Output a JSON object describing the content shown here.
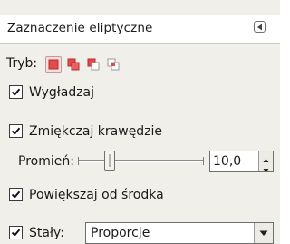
{
  "panel": {
    "title": "Zaznaczenie eliptyczne",
    "mode_label": "Tryb:",
    "modes": [
      "replace",
      "add",
      "subtract",
      "intersect"
    ],
    "active_mode": "replace",
    "antialias": {
      "label": "Wygładzaj",
      "checked": true
    },
    "feather": {
      "label": "Zmiękczaj krawędzie",
      "checked": true
    },
    "radius": {
      "label": "Promień:",
      "value": "10,0"
    },
    "expand_from_center": {
      "label": "Powiększaj od środka",
      "checked": true
    },
    "fixed": {
      "label": "Stały:",
      "checked": true,
      "selected": "Proporcje"
    }
  },
  "colors": {
    "accent": "#e34a4a",
    "panel_bg": "#f0efe9"
  },
  "icons": [
    "panel-menu-icon",
    "mode-replace-icon",
    "mode-add-icon",
    "mode-subtract-icon",
    "mode-intersect-icon",
    "checkmark-icon",
    "spin-up-icon",
    "spin-down-icon",
    "dropdown-arrow-icon"
  ]
}
